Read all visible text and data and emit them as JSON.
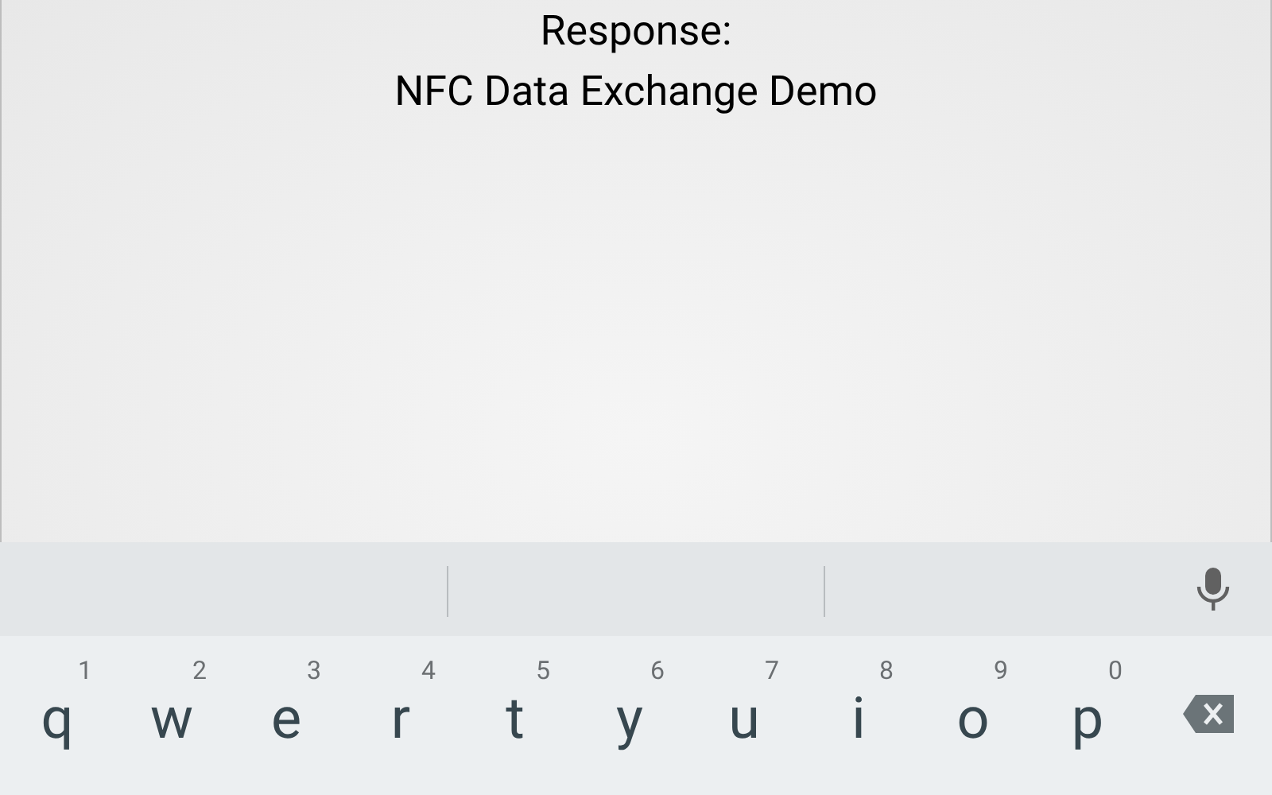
{
  "response": {
    "label": "Response:",
    "message": "NFC Data Exchange Demo"
  },
  "keyboard": {
    "keys": [
      {
        "letter": "q",
        "hint": "1"
      },
      {
        "letter": "w",
        "hint": "2"
      },
      {
        "letter": "e",
        "hint": "3"
      },
      {
        "letter": "r",
        "hint": "4"
      },
      {
        "letter": "t",
        "hint": "5"
      },
      {
        "letter": "y",
        "hint": "6"
      },
      {
        "letter": "u",
        "hint": "7"
      },
      {
        "letter": "i",
        "hint": "8"
      },
      {
        "letter": "o",
        "hint": "9"
      },
      {
        "letter": "p",
        "hint": "0"
      }
    ]
  }
}
